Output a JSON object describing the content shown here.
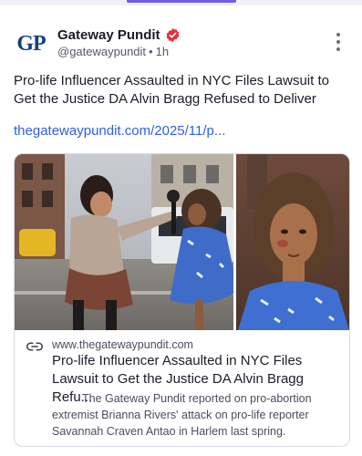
{
  "post": {
    "author_name": "Gateway Pundit",
    "handle": "@gatewaypundit",
    "time": "1h",
    "avatar_text": "GP",
    "text": "Pro-life Influencer Assaulted in NYC Files Lawsuit to Get the Justice DA Alvin Bragg Refused to Deliver",
    "link_text": "thegatewaypundit.com/2025/11/p..."
  },
  "card": {
    "domain": "www.thegatewaypundit.com",
    "title": "Pro-life Influencer Assaulted in NYC Files Lawsuit to Get the Justice DA Alvin Bragg Refu...",
    "description": "The Gateway Pundit reported on pro-abortion extremist Brianna Rivers' attack on pro-life reporter Savannah Craven Antao in Harlem last spring."
  },
  "icons": {
    "verified": "verified-badge-icon",
    "more": "more-vertical-icon",
    "link": "link-icon"
  },
  "colors": {
    "accent": "#6c5ce7",
    "link": "#2f5fe0",
    "verified": "#e2313c",
    "avatar_text": "#16427c"
  }
}
